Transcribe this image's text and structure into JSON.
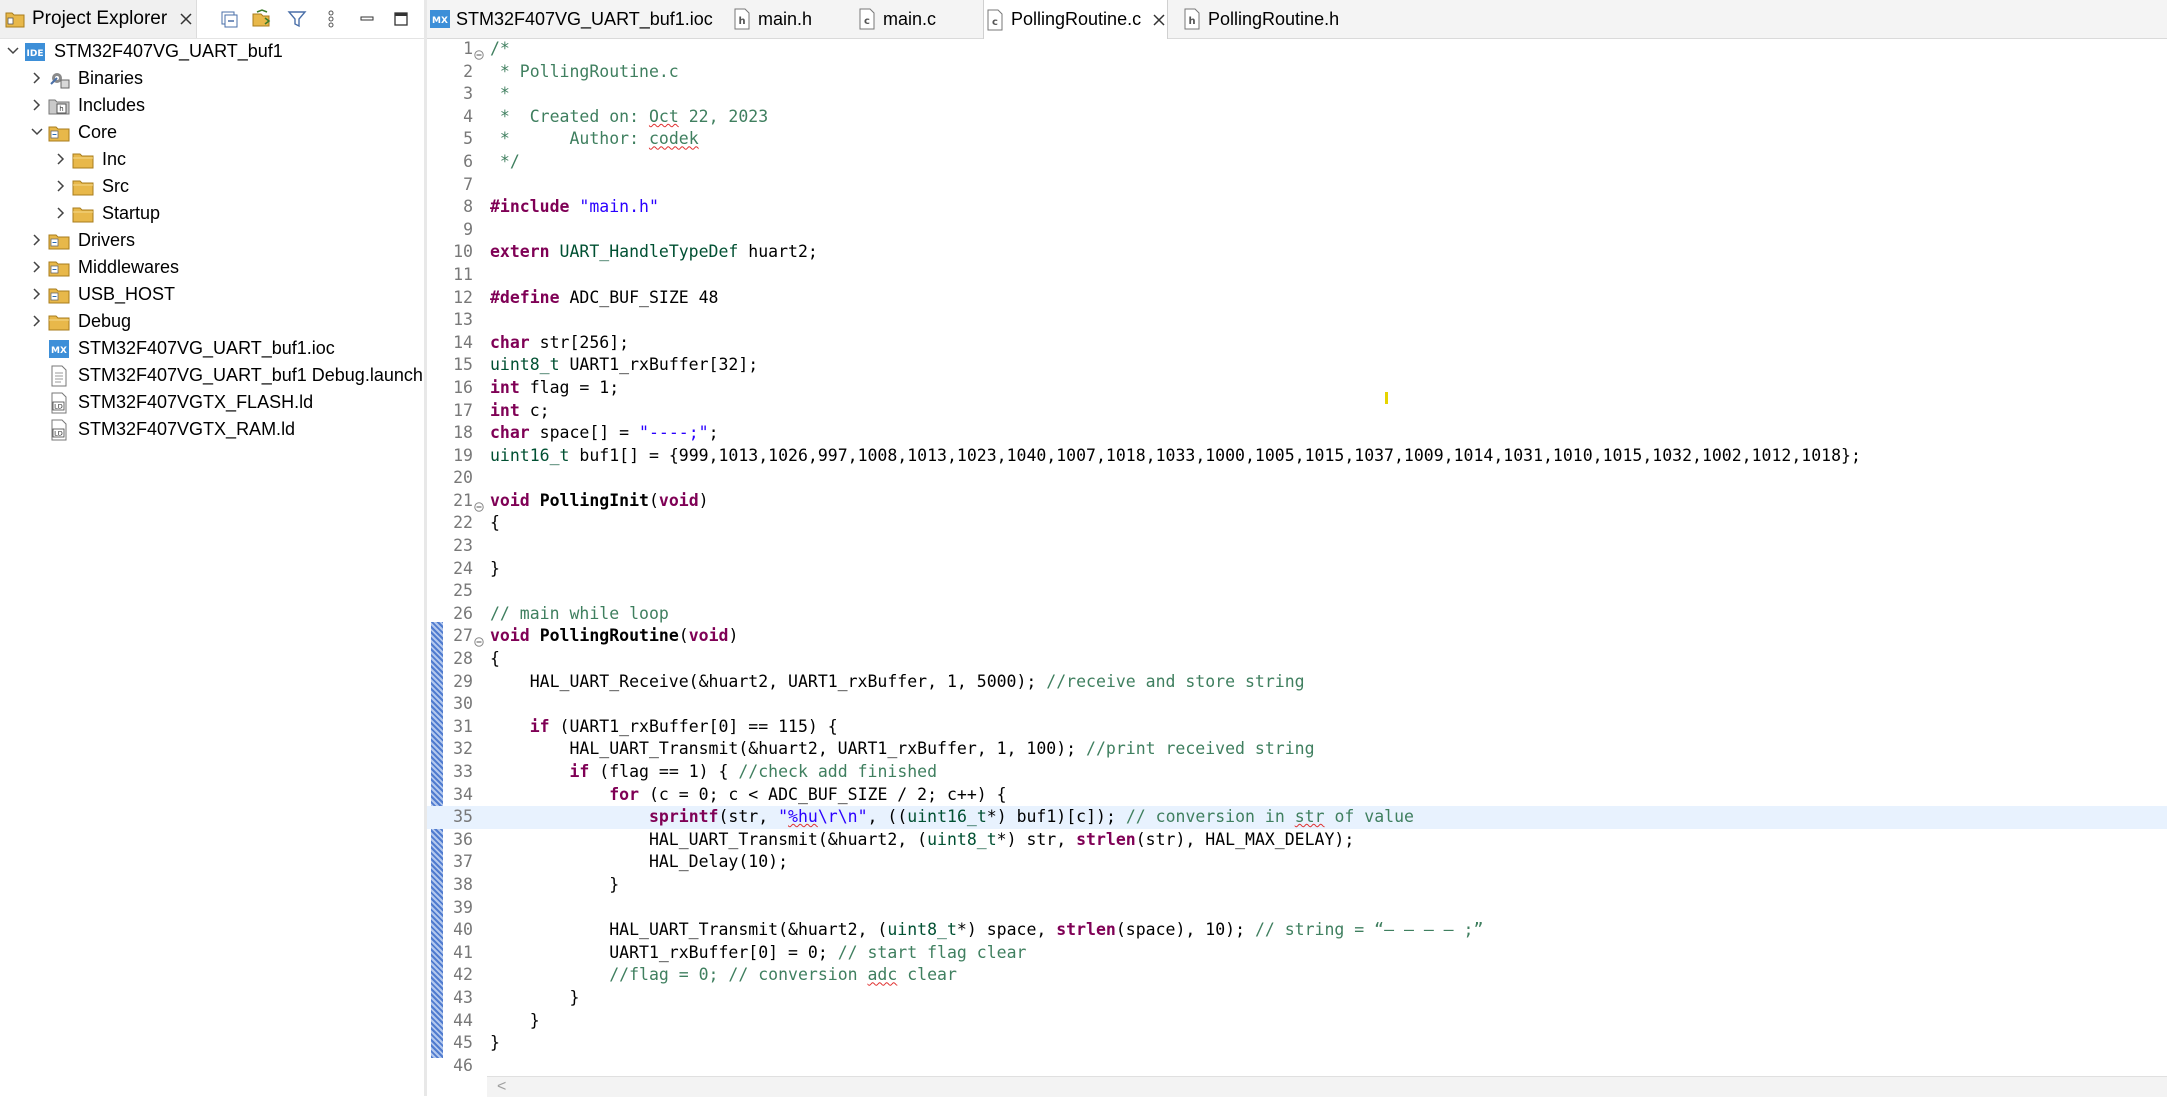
{
  "project_explorer": {
    "tab_label": "Project Explorer",
    "tree": [
      {
        "label": "STM32F407VG_UART_buf1",
        "icon": "ide-project-icon",
        "level": 0,
        "expanded": true
      },
      {
        "label": "Binaries",
        "icon": "binaries-icon",
        "level": 1,
        "expanded": false
      },
      {
        "label": "Includes",
        "icon": "includes-icon",
        "level": 1,
        "expanded": false
      },
      {
        "label": "Core",
        "icon": "source-folder-icon",
        "level": 1,
        "expanded": true
      },
      {
        "label": "Inc",
        "icon": "folder-icon",
        "level": 2,
        "expanded": false
      },
      {
        "label": "Src",
        "icon": "folder-icon",
        "level": 2,
        "expanded": false
      },
      {
        "label": "Startup",
        "icon": "folder-icon",
        "level": 2,
        "expanded": false
      },
      {
        "label": "Drivers",
        "icon": "source-folder-icon",
        "level": 1,
        "expanded": false
      },
      {
        "label": "Middlewares",
        "icon": "source-folder-icon",
        "level": 1,
        "expanded": false
      },
      {
        "label": "USB_HOST",
        "icon": "source-folder-icon",
        "level": 1,
        "expanded": false
      },
      {
        "label": "Debug",
        "icon": "folder-icon",
        "level": 1,
        "expanded": false
      },
      {
        "label": "STM32F407VG_UART_buf1.ioc",
        "icon": "mx-file-icon",
        "level": 1,
        "expanded": null
      },
      {
        "label": "STM32F407VG_UART_buf1 Debug.launch",
        "icon": "launch-file-icon",
        "level": 1,
        "expanded": null
      },
      {
        "label": "STM32F407VGTX_FLASH.ld",
        "icon": "ld-file-icon",
        "level": 1,
        "expanded": null
      },
      {
        "label": "STM32F407VGTX_RAM.ld",
        "icon": "ld-file-icon",
        "level": 1,
        "expanded": null
      }
    ]
  },
  "editor": {
    "tabs": [
      {
        "label": "STM32F407VG_UART_buf1.ioc",
        "icon": "mx-file-icon",
        "active": false
      },
      {
        "label": "main.h",
        "icon": "h-file-icon",
        "active": false
      },
      {
        "label": "main.c",
        "icon": "c-file-icon",
        "active": false
      },
      {
        "label": "PollingRoutine.c",
        "icon": "c-file-icon",
        "active": true
      },
      {
        "label": "PollingRoutine.h",
        "icon": "h-file-icon",
        "active": false
      }
    ],
    "highlighted_line": 35,
    "lines": [
      "/*",
      " * PollingRoutine.c",
      " *",
      " *  Created on: Oct 22, 2023",
      " *      Author: codek",
      " */",
      "",
      "#include \"main.h\"",
      "",
      "extern UART_HandleTypeDef huart2;",
      "",
      "#define ADC_BUF_SIZE 48",
      "",
      "char str[256];",
      "uint8_t UART1_rxBuffer[32];",
      "int flag = 1;",
      "int c;",
      "char space[] = \"----;\";",
      "uint16_t buf1[] = {999,1013,1026,997,1008,1013,1023,1040,1007,1018,1033,1000,1005,1015,1037,1009,1014,1031,1010,1015,1032,1002,1012,1018};",
      "",
      "void PollingInit(void)",
      "{",
      "",
      "}",
      "",
      "// main while loop",
      "void PollingRoutine(void)",
      "{",
      "    HAL_UART_Receive(&huart2, UART1_rxBuffer, 1, 5000); //receive and store string",
      "",
      "    if (UART1_rxBuffer[0] == 115) {",
      "        HAL_UART_Transmit(&huart2, UART1_rxBuffer, 1, 100); //print received string",
      "        if (flag == 1) { //check add finished",
      "            for (c = 0; c < ADC_BUF_SIZE / 2; c++) {",
      "                sprintf(str, \"%hu\\r\\n\", ((uint16_t*) buf1)[c]); // conversion in str of value",
      "                HAL_UART_Transmit(&huart2, (uint8_t*) str, strlen(str), HAL_MAX_DELAY);",
      "                HAL_Delay(10);",
      "            }",
      "",
      "            HAL_UART_Transmit(&huart2, (uint8_t*) space, strlen(space), 10); // string = “– – – – ;”",
      "            UART1_rxBuffer[0] = 0; // start flag clear",
      "            //flag = 0; // conversion adc clear",
      "        }",
      "    }",
      "}",
      ""
    ],
    "fold_lines": [
      1,
      21,
      27
    ]
  },
  "colors": {
    "keyword": "#7f0055",
    "string": "#2a00ff",
    "comment": "#3f7f5f",
    "line_number": "#787878",
    "highlight_line": "#e8f2fe",
    "folder": "#e8b84a"
  }
}
